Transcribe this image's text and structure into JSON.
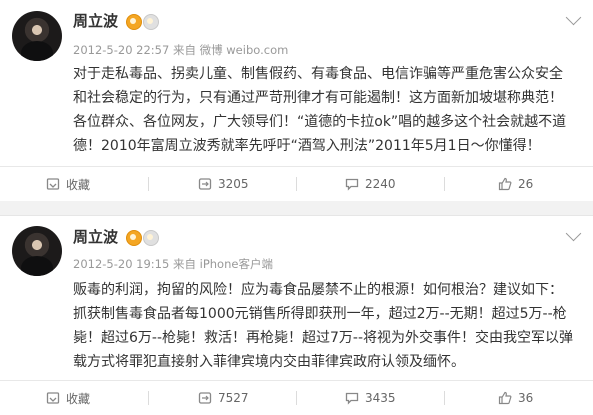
{
  "posts": [
    {
      "author": "周立波",
      "meta": "2012-5-20 22:57 来自 微博 weibo.com",
      "lines": [
        "对于走私毒品、拐卖儿童、制售假药、有毒食品、电信诈骗等严重危害公众安全",
        "和社会稳定的行为，只有通过严苛刑律才有可能遏制！这方面新加坡堪称典范！",
        "各位群众、各位网友，广大领导们！“道德的卡拉ok”唱的越多这个社会就越不道",
        "德！2010年富周立波秀就率先呼吁“酒驾入刑法”2011年5月1日～你懂得！"
      ],
      "actions": {
        "favorite": "收藏",
        "repost": "3205",
        "comment": "2240",
        "like": "26"
      }
    },
    {
      "author": "周立波",
      "meta": "2012-5-20 19:15 来自 iPhone客户端",
      "lines": [
        "贩毒的利润，拘留的风险！应为毒食品屡禁不止的根源！如何根治？建议如下：",
        "抓获制售毒食品者每1000元销售所得即获刑一年，超过2万--无期！超过5万--枪",
        "毙！超过6万--枪毙！救活！再枪毙！超过7万--将视为外交事件！交由我空军以弹",
        "载方式将罪犯直接射入菲律宾境内交由菲律宾政府认领及缅怀。"
      ],
      "actions": {
        "favorite": "收藏",
        "repost": "7527",
        "comment": "3435",
        "like": "36"
      }
    }
  ]
}
